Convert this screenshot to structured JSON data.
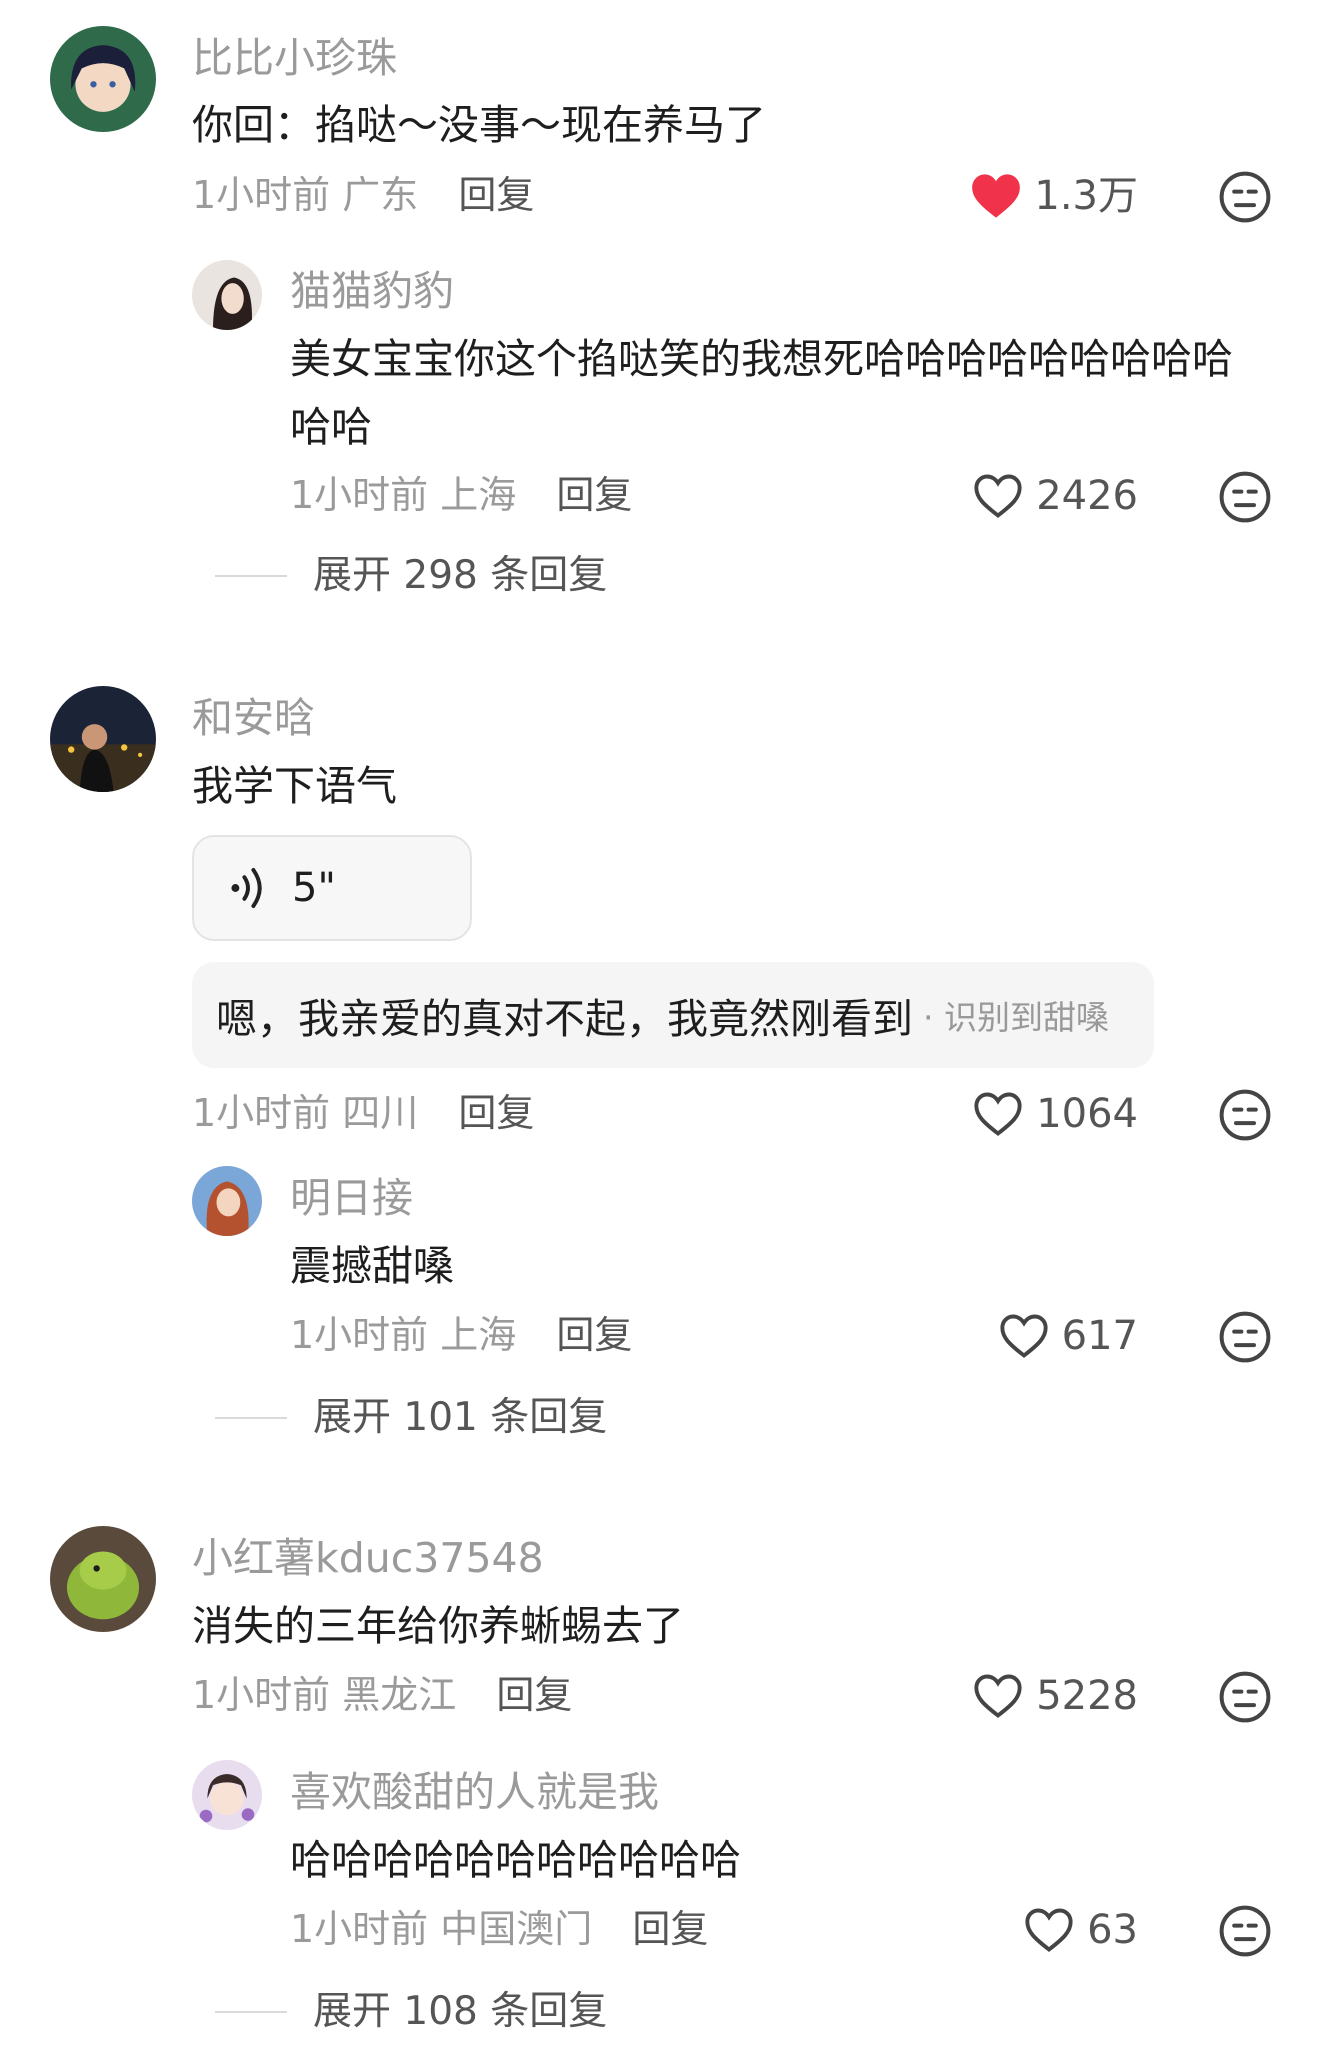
{
  "colors": {
    "like_active": "#f0334a",
    "text_muted": "#9a9a9a",
    "text_main": "#1e1e1e"
  },
  "threads": [
    {
      "author": "比比小珍珠",
      "avatar_icon": "anime-girl-avatar",
      "content": "你回：掐哒～没事～现在养马了",
      "time": "1小时前",
      "location": "广东",
      "reply_label": "回复",
      "likes": "1.3万",
      "liked": true,
      "reply": {
        "author": "猫猫豹豹",
        "avatar_icon": "woman-portrait-avatar",
        "content": "美女宝宝你这个掐哒笑的我想死哈哈哈哈哈哈哈哈哈哈哈",
        "time": "1小时前",
        "location": "上海",
        "reply_label": "回复",
        "likes": "2426"
      },
      "expand_label": "展开 298 条回复"
    },
    {
      "author": "和安晗",
      "avatar_icon": "night-city-man-avatar",
      "content": "我学下语气",
      "voice_duration": "5\"",
      "transcript": "嗯，我亲爱的真对不起，我竟然刚看到",
      "transcript_tag": "· 识别到甜嗓",
      "time": "1小时前",
      "location": "四川",
      "reply_label": "回复",
      "likes": "1064",
      "reply": {
        "author": "明日接",
        "avatar_icon": "anime-redhead-avatar",
        "content": "震撼甜嗓",
        "time": "1小时前",
        "location": "上海",
        "reply_label": "回复",
        "likes": "617"
      },
      "expand_label": "展开 101 条回复"
    },
    {
      "author": "小红薯kduc37548",
      "avatar_icon": "green-parrot-avatar",
      "content": "消失的三年给你养蜥蜴去了",
      "time": "1小时前",
      "location": "黑龙江",
      "reply_label": "回复",
      "likes": "5228",
      "reply": {
        "author": "喜欢酸甜的人就是我",
        "avatar_icon": "cartoon-girl-avatar",
        "content": "哈哈哈哈哈哈哈哈哈哈哈",
        "time": "1小时前",
        "location": "中国澳门",
        "reply_label": "回复",
        "likes": "63"
      },
      "expand_label": "展开 108 条回复"
    }
  ]
}
